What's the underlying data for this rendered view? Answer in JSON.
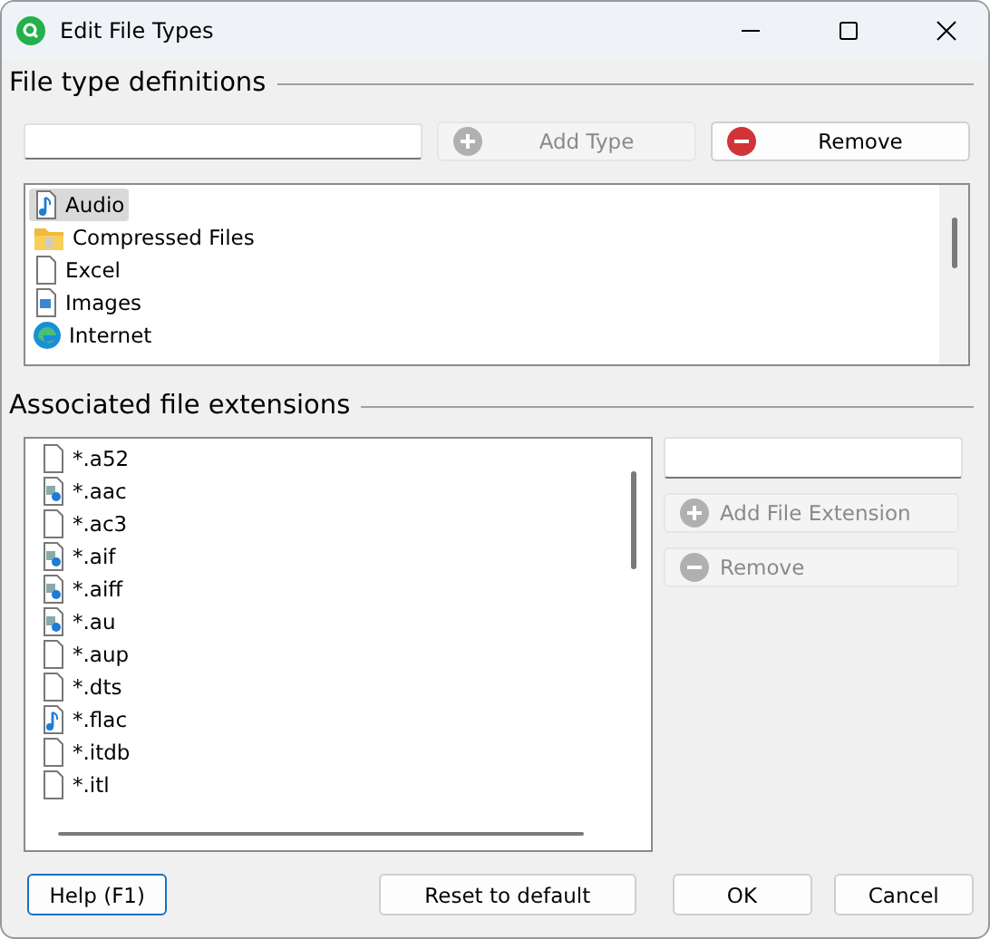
{
  "window": {
    "title": "Edit File Types"
  },
  "type_section": {
    "title": "File type definitions",
    "buttons": [
      {
        "label": "Add Type",
        "kind": "add",
        "disabled": true
      },
      {
        "label": "Remove",
        "kind": "remove",
        "disabled": false
      }
    ],
    "types": [
      {
        "label": "Audio",
        "kind": "music",
        "selected": true
      },
      {
        "label": "Compressed Files",
        "kind": "folder",
        "selected": false
      },
      {
        "label": "Excel",
        "kind": "plain",
        "selected": false
      },
      {
        "label": "Images",
        "kind": "image",
        "selected": false
      },
      {
        "label": "Internet",
        "kind": "web",
        "selected": false
      }
    ]
  },
  "extension_section": {
    "title": "Associated file extensions",
    "buttons": [
      {
        "label": "Add File Extension",
        "kind": "add",
        "disabled": true
      },
      {
        "label": "Remove",
        "kind": "remove",
        "disabled": true
      }
    ],
    "extensions": [
      {
        "label": "*.a52",
        "kind": "plain"
      },
      {
        "label": "*.aac",
        "kind": "media"
      },
      {
        "label": "*.ac3",
        "kind": "plain"
      },
      {
        "label": "*.aif",
        "kind": "media"
      },
      {
        "label": "*.aiff",
        "kind": "media"
      },
      {
        "label": "*.au",
        "kind": "media"
      },
      {
        "label": "*.aup",
        "kind": "plain"
      },
      {
        "label": "*.dts",
        "kind": "plain"
      },
      {
        "label": "*.flac",
        "kind": "music"
      },
      {
        "label": "*.itdb",
        "kind": "plain"
      },
      {
        "label": "*.itl",
        "kind": "plain"
      }
    ]
  },
  "footer": [
    {
      "label": "Help (F1)",
      "focused": true
    },
    {
      "label": "Reset to default",
      "focused": false
    },
    {
      "label": "OK",
      "focused": false
    },
    {
      "label": "Cancel",
      "focused": false
    }
  ]
}
